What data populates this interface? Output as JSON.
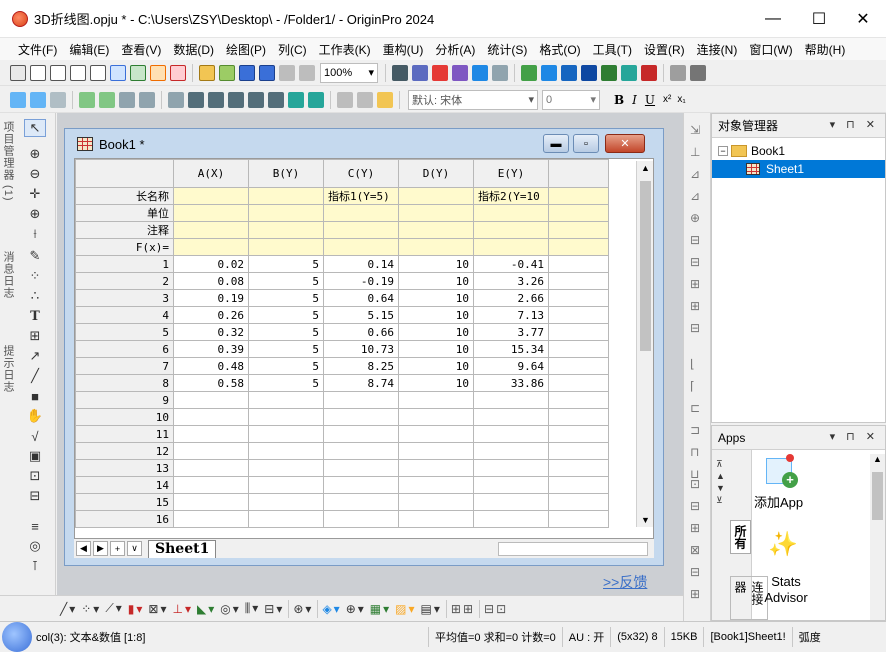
{
  "window": {
    "title": "3D折线图.opju * - C:\\Users\\ZSY\\Desktop\\ - /Folder1/ - OriginPro 2024",
    "minimize": "—",
    "maximize": "☐",
    "close": "✕"
  },
  "menu": [
    "文件(F)",
    "编辑(E)",
    "查看(V)",
    "数据(D)",
    "绘图(P)",
    "列(C)",
    "工作表(K)",
    "重构(U)",
    "分析(A)",
    "统计(S)",
    "格式(O)",
    "工具(T)",
    "设置(R)",
    "连接(N)",
    "窗口(W)",
    "帮助(H)"
  ],
  "toolbar": {
    "zoom": "100%",
    "font": "默认: 宋体",
    "font_size": "0"
  },
  "left_toolbar": {
    "label1": "项目管理器 (1)",
    "label2": "消息日志",
    "label3": "提示日志"
  },
  "book": {
    "title": "Book1 *",
    "columns": [
      "A(X)",
      "B(Y)",
      "C(Y)",
      "D(Y)",
      "E(Y)"
    ],
    "meta_rows": [
      {
        "label": "长名称",
        "values": [
          "",
          "",
          "指标1(Y=5)",
          "",
          "指标2(Y=10"
        ]
      },
      {
        "label": "单位",
        "values": [
          "",
          "",
          "",
          "",
          ""
        ]
      },
      {
        "label": "注释",
        "values": [
          "",
          "",
          "",
          "",
          ""
        ]
      },
      {
        "label": "F(x)=",
        "values": [
          "",
          "",
          "",
          "",
          ""
        ]
      }
    ],
    "rows": [
      {
        "n": "1",
        "v": [
          "0.02",
          "5",
          "0.14",
          "10",
          "-0.41"
        ]
      },
      {
        "n": "2",
        "v": [
          "0.08",
          "5",
          "-0.19",
          "10",
          "3.26"
        ]
      },
      {
        "n": "3",
        "v": [
          "0.19",
          "5",
          "0.64",
          "10",
          "2.66"
        ]
      },
      {
        "n": "4",
        "v": [
          "0.26",
          "5",
          "5.15",
          "10",
          "7.13"
        ]
      },
      {
        "n": "5",
        "v": [
          "0.32",
          "5",
          "0.66",
          "10",
          "3.77"
        ]
      },
      {
        "n": "6",
        "v": [
          "0.39",
          "5",
          "10.73",
          "10",
          "15.34"
        ]
      },
      {
        "n": "7",
        "v": [
          "0.48",
          "5",
          "8.25",
          "10",
          "9.64"
        ]
      },
      {
        "n": "8",
        "v": [
          "0.58",
          "5",
          "8.74",
          "10",
          "33.86"
        ]
      },
      {
        "n": "9",
        "v": [
          "",
          "",
          "",
          "",
          ""
        ]
      },
      {
        "n": "10",
        "v": [
          "",
          "",
          "",
          "",
          ""
        ]
      },
      {
        "n": "11",
        "v": [
          "",
          "",
          "",
          "",
          ""
        ]
      },
      {
        "n": "12",
        "v": [
          "",
          "",
          "",
          "",
          ""
        ]
      },
      {
        "n": "13",
        "v": [
          "",
          "",
          "",
          "",
          ""
        ]
      },
      {
        "n": "14",
        "v": [
          "",
          "",
          "",
          "",
          ""
        ]
      },
      {
        "n": "15",
        "v": [
          "",
          "",
          "",
          "",
          ""
        ]
      },
      {
        "n": "16",
        "v": [
          "",
          "",
          "",
          "",
          ""
        ]
      }
    ],
    "sheet_tab": "Sheet1"
  },
  "feedback": ">>反馈",
  "object_manager": {
    "title": "对象管理器",
    "book": "Book1",
    "sheet": "Sheet1"
  },
  "apps": {
    "title": "Apps",
    "tab_all": "所有",
    "tab_conn": "连接器",
    "add_app": "添加App",
    "stats_advisor": "Stats Advisor"
  },
  "status": {
    "col_info": "col(3): 文本&数值 [1:8]",
    "stats": "平均值=0 求和=0 计数=0",
    "au": "AU : 开",
    "dims": "(5x32) 8",
    "size": "15KB",
    "ref": "[Book1]Sheet1!",
    "angle": "弧度"
  }
}
